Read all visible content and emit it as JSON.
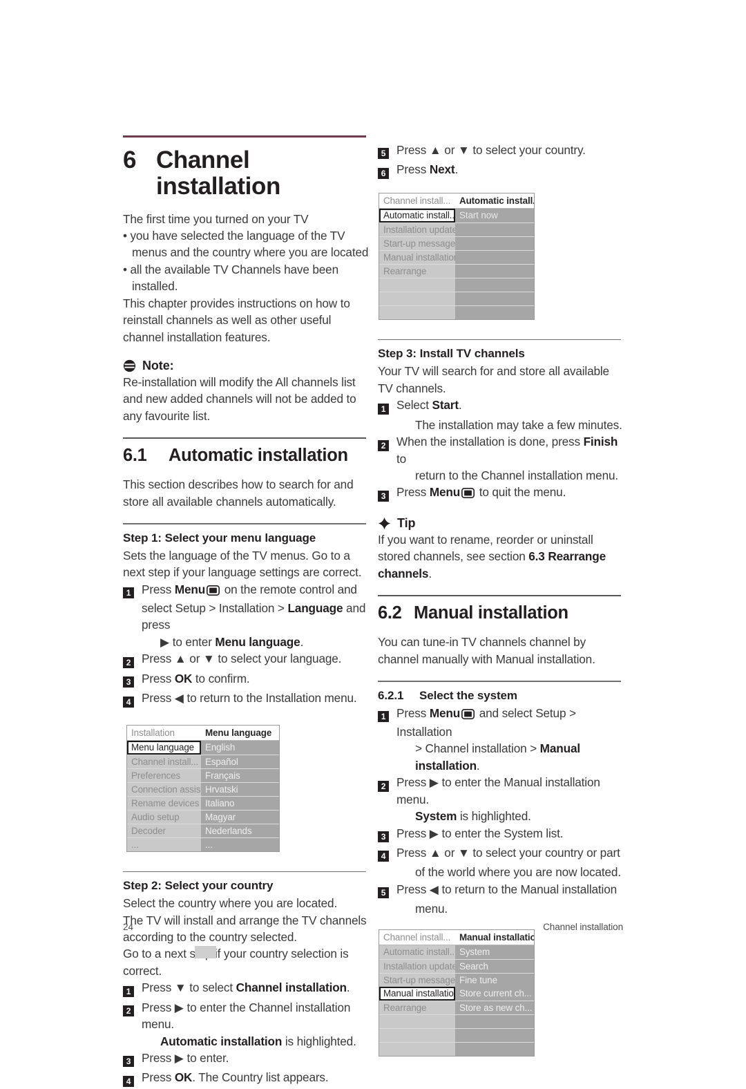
{
  "page": {
    "number": "24",
    "footer_title": "Channel installation",
    "accent_rule_color": "#6b3a4b"
  },
  "chapter": {
    "number": "6",
    "title": "Channel installation"
  },
  "intro": {
    "lead": "The first time you turned on your TV",
    "bullets": [
      "• you have selected the language of the TV menus and the country where you are located",
      "• all the available TV Channels have been installed."
    ],
    "after": "This chapter provides instructions on how to reinstall channels as well as other useful channel installation features."
  },
  "note": {
    "icon": "note-icon",
    "label": "Note:",
    "text": "Re-installation will modify the All channels list and new added channels will not be added to any favourite list."
  },
  "section61": {
    "number": "6.1",
    "title": "Automatic installation",
    "intro": "This section describes how to search for and store all available channels automatically."
  },
  "step1": {
    "title": "Step 1: Select your menu language",
    "intro": "Sets the language of the TV menus. Go to a next step if your language settings are correct.",
    "items": [
      {
        "n": "1",
        "pre": "Press ",
        "b1": "Menu",
        "icon": "menu-icon",
        "mid": " on the remote control and select Setup > Installation > ",
        "b2": "Language",
        "post": " and press"
      },
      {
        "n": "",
        "cont": "▶ to enter ",
        "b1": "Menu language",
        "post": "."
      },
      {
        "n": "2",
        "text": "Press ▲ or ▼ to select your language."
      },
      {
        "n": "3",
        "pre": "Press ",
        "b1": "OK",
        "post": " to confirm."
      },
      {
        "n": "4",
        "text": "Press ◀ to return to the Installation menu."
      }
    ]
  },
  "installation_menu": {
    "name": "installation-menu-screenshot",
    "header": {
      "left": "Installation",
      "right": "Menu language"
    },
    "rows": [
      {
        "left": "Menu language",
        "right": "English",
        "selected": true
      },
      {
        "left": "Channel install...",
        "right": "Español"
      },
      {
        "left": "Preferences",
        "right": "Français"
      },
      {
        "left": "Connection assist.",
        "right": "Hrvatski"
      },
      {
        "left": "Rename devices",
        "right": "Italiano"
      },
      {
        "left": "Audio setup",
        "right": "Magyar"
      },
      {
        "left": "Decoder",
        "right": "Nederlands"
      },
      {
        "left": "...",
        "right": "..."
      }
    ]
  },
  "step2": {
    "title": "Step 2:  Select your country",
    "intro1": "Select the country where you are located.",
    "intro2": "The TV will install and arrange the TV channels according to the country selected.",
    "intro3": "Go to a next step if your country selection is correct.",
    "items": [
      {
        "n": "1",
        "pre": "Press ▼ to select ",
        "b1": "Channel installation",
        "post": "."
      },
      {
        "n": "2",
        "text": "Press ▶ to enter the Channel installation menu."
      },
      {
        "n": "",
        "contb": "Automatic installation",
        "contpost": " is highlighted."
      },
      {
        "n": "3",
        "text": "Press ▶ to enter."
      },
      {
        "n": "4",
        "pre": "Press ",
        "b1": "OK",
        "post": ". The Country list appears."
      }
    ]
  },
  "step2_right": {
    "items": [
      {
        "n": "5",
        "text": "Press ▲ or ▼ to select your country."
      },
      {
        "n": "6",
        "pre": "Press ",
        "b1": "Next",
        "post": "."
      }
    ]
  },
  "auto_install_menu": {
    "name": "automatic-installation-menu-screenshot",
    "header": {
      "left": "Channel install...",
      "right": "Automatic install..."
    },
    "rows": [
      {
        "left": "Automatic install...",
        "right": "Start now",
        "selected": true,
        "right_highlight": true
      },
      {
        "left": "Installation update",
        "right": ""
      },
      {
        "left": "Start-up message",
        "right": ""
      },
      {
        "left": "Manual installation",
        "right": ""
      },
      {
        "left": "Rearrange",
        "right": ""
      },
      {
        "left": "",
        "right": ""
      },
      {
        "left": "",
        "right": ""
      },
      {
        "left": "",
        "right": ""
      }
    ]
  },
  "step3": {
    "title": "Step 3:  Install TV channels",
    "intro": "Your TV will search for and store all available TV channels.",
    "items": [
      {
        "n": "1",
        "pre": "Select ",
        "b1": "Start",
        "post": "."
      },
      {
        "n": "",
        "cont_plain": "The installation may take a few minutes."
      },
      {
        "n": "2",
        "pre": "When the installation is done, press ",
        "b1": "Finish",
        "post": " to"
      },
      {
        "n": "",
        "cont_plain": "return to the Channel installation menu."
      },
      {
        "n": "3",
        "pre": "Press ",
        "b1": "Menu",
        "icon": "menu-icon",
        "post": " to quit the menu."
      }
    ]
  },
  "tip": {
    "icon": "tip-icon",
    "label": "Tip",
    "pre": "If you want to rename, reorder or uninstall stored channels, see section ",
    "b1": "6.3 Rearrange channels",
    "post": "."
  },
  "section62": {
    "number": "6.2",
    "title": "Manual installation",
    "intro": "You can tune-in TV channels channel by channel manually with Manual installation."
  },
  "section621": {
    "number": "6.2.1",
    "title": "Select the system",
    "items": [
      {
        "n": "1",
        "pre": "Press ",
        "b1": "Menu",
        "icon": "menu-icon",
        "post": " and select Setup > Installation"
      },
      {
        "n": "",
        "cont_pre": "> Channel installation > ",
        "cont_b": "Manual installation",
        "cont_post": "."
      },
      {
        "n": "2",
        "text": "Press ▶ to enter the Manual installation menu."
      },
      {
        "n": "",
        "contb": "System",
        "contpost": " is highlighted."
      },
      {
        "n": "3",
        "text": "Press ▶ to enter the System list."
      },
      {
        "n": "4",
        "text": "Press ▲ or ▼ to select your country or part"
      },
      {
        "n": "",
        "cont_plain": "of the world where you are now located."
      },
      {
        "n": "5",
        "text": "Press ◀ to return to the Manual installation"
      },
      {
        "n": "",
        "cont_plain": "menu."
      }
    ]
  },
  "manual_install_menu": {
    "name": "manual-installation-menu-screenshot",
    "header": {
      "left": "Channel install...",
      "right": "Manual installation"
    },
    "rows": [
      {
        "left": "Automatic install...",
        "right": "System"
      },
      {
        "left": "Installation update",
        "right": "Search"
      },
      {
        "left": "Start-up message",
        "right": "Fine tune"
      },
      {
        "left": "Manual installation",
        "right": "Store current ch...",
        "selected": true
      },
      {
        "left": "Rearrange",
        "right": "Store as new ch..."
      },
      {
        "left": "",
        "right": ""
      },
      {
        "left": "",
        "right": ""
      },
      {
        "left": "",
        "right": ""
      }
    ]
  }
}
